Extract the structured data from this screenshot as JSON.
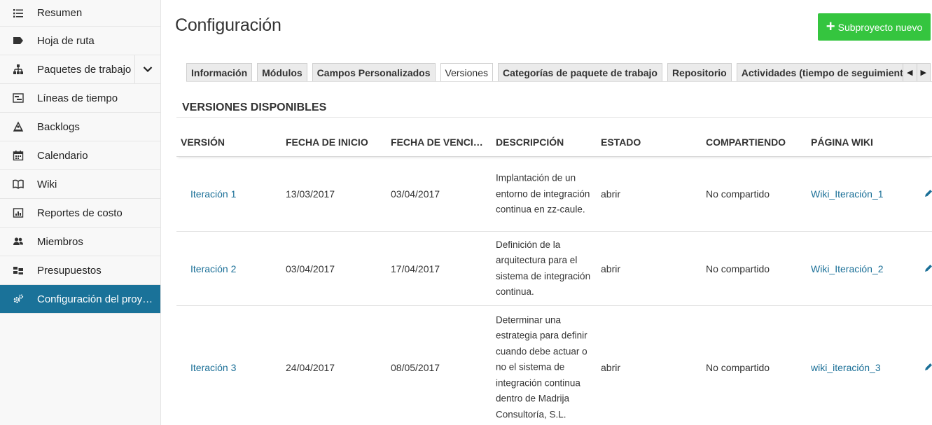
{
  "sidebar": {
    "items": [
      {
        "label": "Resumen",
        "icon": "list-icon"
      },
      {
        "label": "Hoja de ruta",
        "icon": "tag-icon"
      },
      {
        "label": "Paquetes de trabajo",
        "icon": "hierarchy-icon"
      },
      {
        "label": "Líneas de tiempo",
        "icon": "timeline-icon"
      },
      {
        "label": "Backlogs",
        "icon": "backlogs-icon"
      },
      {
        "label": "Calendario",
        "icon": "calendar-icon"
      },
      {
        "label": "Wiki",
        "icon": "book-icon"
      },
      {
        "label": "Reportes de costo",
        "icon": "cost-report-icon"
      },
      {
        "label": "Miembros",
        "icon": "members-icon"
      },
      {
        "label": "Presupuestos",
        "icon": "budget-icon"
      },
      {
        "label": "Configuración del proyec...",
        "icon": "gears-icon",
        "active": true
      }
    ]
  },
  "header": {
    "title": "Configuración",
    "new_button_label": "Subproyecto nuevo"
  },
  "tabs": [
    {
      "label": "Información"
    },
    {
      "label": "Módulos"
    },
    {
      "label": "Campos Personalizados"
    },
    {
      "label": "Versiones",
      "active": true
    },
    {
      "label": "Categorías de paquete de trabajo"
    },
    {
      "label": "Repositorio"
    },
    {
      "label": "Actividades (tiempo de seguimiento)"
    }
  ],
  "section": {
    "title": "VERSIONES DISPONIBLES"
  },
  "table": {
    "columns": [
      "VERSIÓN",
      "FECHA DE INICIO",
      "FECHA DE VENCIM...",
      "DESCRIPCIÓN",
      "ESTADO",
      "COMPARTIENDO",
      "PÁGINA WIKI"
    ],
    "rows": [
      {
        "version": "Iteración 1",
        "start": "13/03/2017",
        "due": "03/04/2017",
        "description": "Implantación de un entorno de integración continua en zz-caule.",
        "status": "abrir",
        "sharing": "No compartido",
        "wiki": "Wiki_Iteración_1"
      },
      {
        "version": "Iteración 2",
        "start": "03/04/2017",
        "due": "17/04/2017",
        "description": "Definición de la arquitectura para el sistema de integración continua.",
        "status": "abrir",
        "sharing": "No compartido",
        "wiki": "Wiki_Iteración_2"
      },
      {
        "version": "Iteración 3",
        "start": "24/04/2017",
        "due": "08/05/2017",
        "description": "Determinar una estrategia para definir cuando debe actuar o no el sistema de integración continua dentro de Madrija Consultoría, S.L.",
        "status": "abrir",
        "sharing": "No compartido",
        "wiki": "wiki_iteración_3"
      }
    ]
  },
  "colors": {
    "accent": "#1a7299",
    "link": "#1a6f97",
    "new_button": "#35c53f"
  }
}
